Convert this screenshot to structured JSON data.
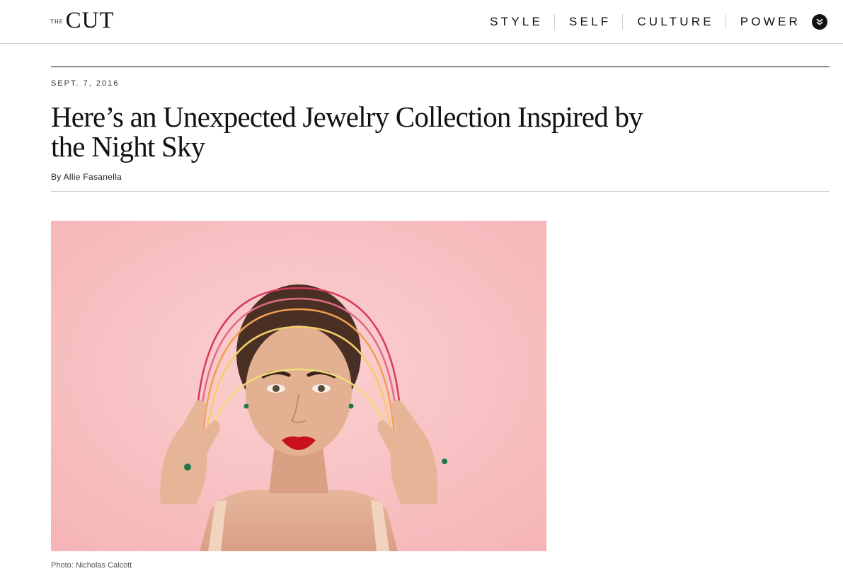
{
  "header": {
    "logo_small": "THE",
    "logo_large": "CUT",
    "nav": [
      "STYLE",
      "SELF",
      "CULTURE",
      "POWER"
    ],
    "menu_icon": "chevron-down-icon",
    "menu_icon_color": "#111111"
  },
  "article": {
    "date": "SEPT. 7, 2016",
    "headline": "Here’s an Unexpected Jewelry Collection Inspired by the Night Sky",
    "byline_prefix": "By",
    "author": "Allie Fasanella"
  },
  "photo": {
    "background_color": "#f7bdbf",
    "caption": "Photo: Nicholas Calcott"
  }
}
